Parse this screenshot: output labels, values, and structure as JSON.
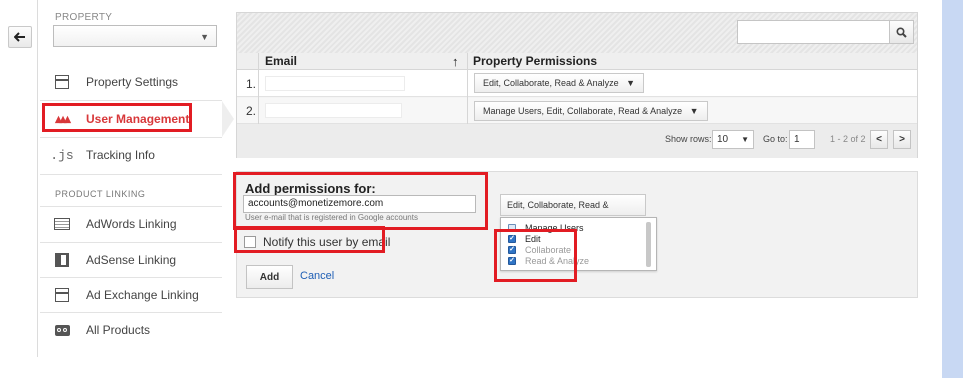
{
  "nav": {
    "back_label": "←"
  },
  "sidebar": {
    "property_label": "PROPERTY",
    "property_value": "",
    "items": [
      {
        "label": "Property Settings",
        "icon": "page-icon"
      },
      {
        "label": "User Management",
        "icon": "users-icon"
      },
      {
        "label": "Tracking Info",
        "icon": "js-icon",
        "icon_text": ".js"
      }
    ],
    "product_linking_label": "PRODUCT LINKING",
    "linking_items": [
      {
        "label": "AdWords Linking",
        "icon": "card-icon"
      },
      {
        "label": "AdSense Linking",
        "icon": "adsense-icon"
      },
      {
        "label": "Ad Exchange Linking",
        "icon": "page-icon"
      },
      {
        "label": "All Products",
        "icon": "link-icon"
      }
    ]
  },
  "table": {
    "search_placeholder": "",
    "columns": {
      "email": "Email",
      "permissions": "Property Permissions",
      "sort_icon": "↑"
    },
    "rows": [
      {
        "num": "1.",
        "email": "",
        "permissions": "Edit, Collaborate, Read & Analyze"
      },
      {
        "num": "2.",
        "email": "",
        "permissions": "Manage Users, Edit, Collaborate, Read & Analyze"
      }
    ],
    "footer": {
      "show_rows_label": "Show rows:",
      "show_rows_value": "10",
      "goto_label": "Go to:",
      "goto_value": "1",
      "range": "1 - 2 of 2",
      "prev": "<",
      "next": ">"
    }
  },
  "add_permissions": {
    "title": "Add permissions for:",
    "email_value": "accounts@monetizemore.com",
    "hint": "User e-mail that is registered in Google accounts",
    "permissions_value": "Edit, Collaborate, Read & Analyze",
    "options": [
      {
        "label": "Manage Users",
        "checked": false
      },
      {
        "label": "Edit",
        "checked": true
      },
      {
        "label": "Collaborate",
        "checked": true
      },
      {
        "label": "Read & Analyze",
        "checked": true
      }
    ],
    "notify_label": "Notify this user by email",
    "add_label": "Add",
    "cancel_label": "Cancel"
  },
  "colors": {
    "active": "#d8383a",
    "highlight_box": "#e21c23",
    "link": "#1f5fb5",
    "checkbox": "#2f74c5"
  }
}
